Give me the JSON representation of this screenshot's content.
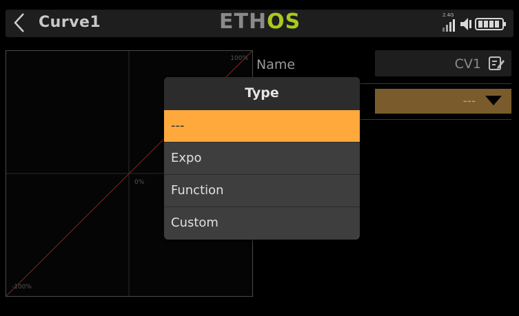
{
  "header": {
    "title": "Curve1",
    "logo_part1": "ETH",
    "logo_part2": "OS",
    "status_label": "2.4G"
  },
  "graph": {
    "label_top": "100%",
    "label_center": "0%",
    "label_bottom": "-100%"
  },
  "form": {
    "name_label": "Name",
    "name_value": "CV1",
    "type_value": "---"
  },
  "popup": {
    "title": "Type",
    "options": [
      {
        "label": "---",
        "selected": true
      },
      {
        "label": "Expo",
        "selected": false
      },
      {
        "label": "Function",
        "selected": false
      },
      {
        "label": "Custom",
        "selected": false
      }
    ]
  },
  "colors": {
    "accent": "#ffa93c",
    "logo_green": "#a8c91e",
    "type_field_bg": "#7a5c2c",
    "curve_line": "#7a2a2a"
  }
}
